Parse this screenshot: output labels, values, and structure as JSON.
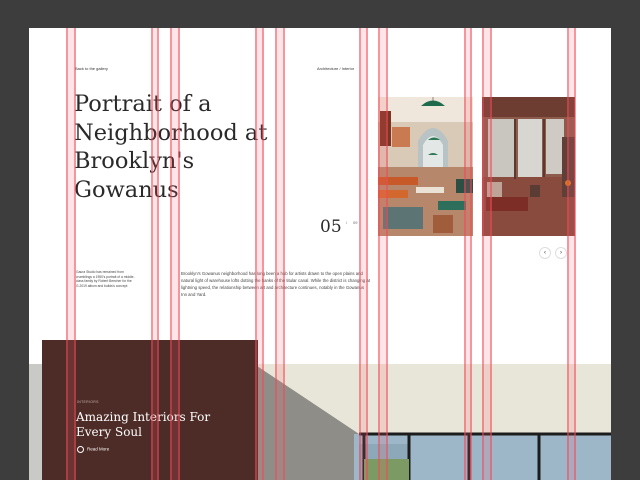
{
  "nav": {
    "back_label": "Back to the gallery",
    "category_label": "Architecture / Interior"
  },
  "article": {
    "title": "Portrait of a Neighborhood at Brooklyn's Gowanus",
    "slide_current": "05",
    "slide_separator": "/",
    "slide_total": "09",
    "caption": "Gaura Studio has remained from crumblings a 1950's portrait of a middle-class family by Robert Beecher for the G.2019 album and builds's concept",
    "body": "Brooklyn's Gowanus neighborhood has long been a hub for artists drawn to the open plains and natural light of warehouse lofts dotting the banks of the titular canal. While the district is changing at lightning speed, the relationship between art and architecture continues, notably in the Gowanus Inn and Yard."
  },
  "gallery": {
    "prev_icon": "‹",
    "next_icon": "›"
  },
  "promo": {
    "section_label": "INTERIORS",
    "title": "Amazing Interiors For Every Soul",
    "read_more": "Read More"
  },
  "colors": {
    "background": "#3d3d3d",
    "promo_panel": "#4d2b26",
    "grid_overlay": "#f04655"
  }
}
